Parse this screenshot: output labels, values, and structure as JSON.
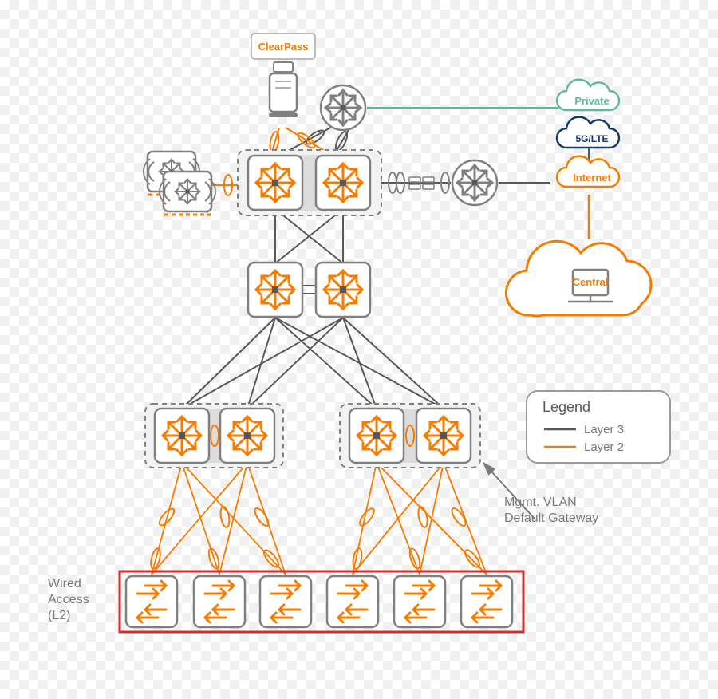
{
  "labels": {
    "clearpass": "ClearPass",
    "private": "Private",
    "fiveg": "5G/LTE",
    "internet": "Internet",
    "central": "Central",
    "legendTitle": "Legend",
    "legendL3": "Layer 3",
    "legendL2": "Layer 2",
    "mgmt1": "Mgmt. VLAN",
    "mgmt2": "Default Gateway",
    "wired1": "Wired",
    "wired2": "Access",
    "wired3": "(L2)"
  },
  "colors": {
    "orange": "#f57c00",
    "grey": "#808080",
    "darkGrey": "#585858",
    "navy": "#143a6b",
    "teal": "#5fb7a0",
    "red": "#d03030",
    "boxFill": "#ffffff",
    "boxStroke": "#808080",
    "dashFill": "#f2f2f2"
  }
}
